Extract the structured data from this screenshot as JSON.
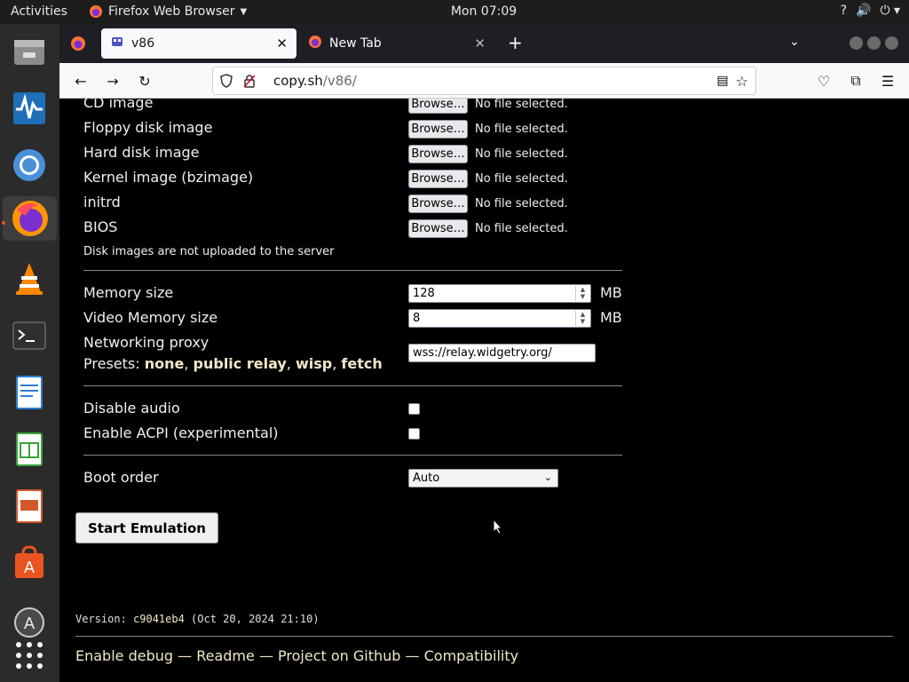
{
  "topbar": {
    "activities": "Activities",
    "app_name": "Firefox Web Browser",
    "clock": "Mon 07:09"
  },
  "dock": {
    "items": [
      "files-icon",
      "system-monitor-icon",
      "chromium-icon",
      "firefox-icon",
      "vlc-icon",
      "terminal-icon",
      "writer-icon",
      "calc-icon",
      "impress-icon",
      "software-center-icon",
      "updates-icon",
      "show-apps-icon"
    ]
  },
  "tabs": [
    {
      "title": "v86",
      "selected": true
    },
    {
      "title": "New Tab",
      "selected": false
    }
  ],
  "url": {
    "host": "copy.sh",
    "path": "/v86/"
  },
  "form": {
    "file_inputs": [
      {
        "label": "CD image",
        "button": "Browse…",
        "status": "No file selected."
      },
      {
        "label": "Floppy disk image",
        "button": "Browse…",
        "status": "No file selected."
      },
      {
        "label": "Hard disk image",
        "button": "Browse…",
        "status": "No file selected."
      },
      {
        "label": "Kernel image (bzimage)",
        "button": "Browse…",
        "status": "No file selected."
      },
      {
        "label": "initrd",
        "button": "Browse…",
        "status": "No file selected."
      },
      {
        "label": "BIOS",
        "button": "Browse…",
        "status": "No file selected."
      }
    ],
    "upload_note": "Disk images are not uploaded to the server",
    "memory_label": "Memory size",
    "memory_value": "128",
    "memory_unit": "MB",
    "vram_label": "Video Memory size",
    "vram_value": "8",
    "vram_unit": "MB",
    "proxy_label": "Networking proxy",
    "presets_label": "Presets:",
    "presets": [
      "none",
      "public relay",
      "wisp",
      "fetch"
    ],
    "proxy_value": "wss://relay.widgetry.org/",
    "disable_audio_label": "Disable audio",
    "acpi_label": "Enable ACPI (experimental)",
    "boot_order_label": "Boot order",
    "boot_order_value": "Auto",
    "start_button": "Start Emulation"
  },
  "version": {
    "prefix": "Version: ",
    "hash": "c9041eb4",
    "date": " (Oct 20, 2024 21:10)"
  },
  "footer": {
    "links": [
      "Enable debug",
      "Readme",
      "Project on Github",
      "Compatibility"
    ],
    "separator": " — "
  }
}
